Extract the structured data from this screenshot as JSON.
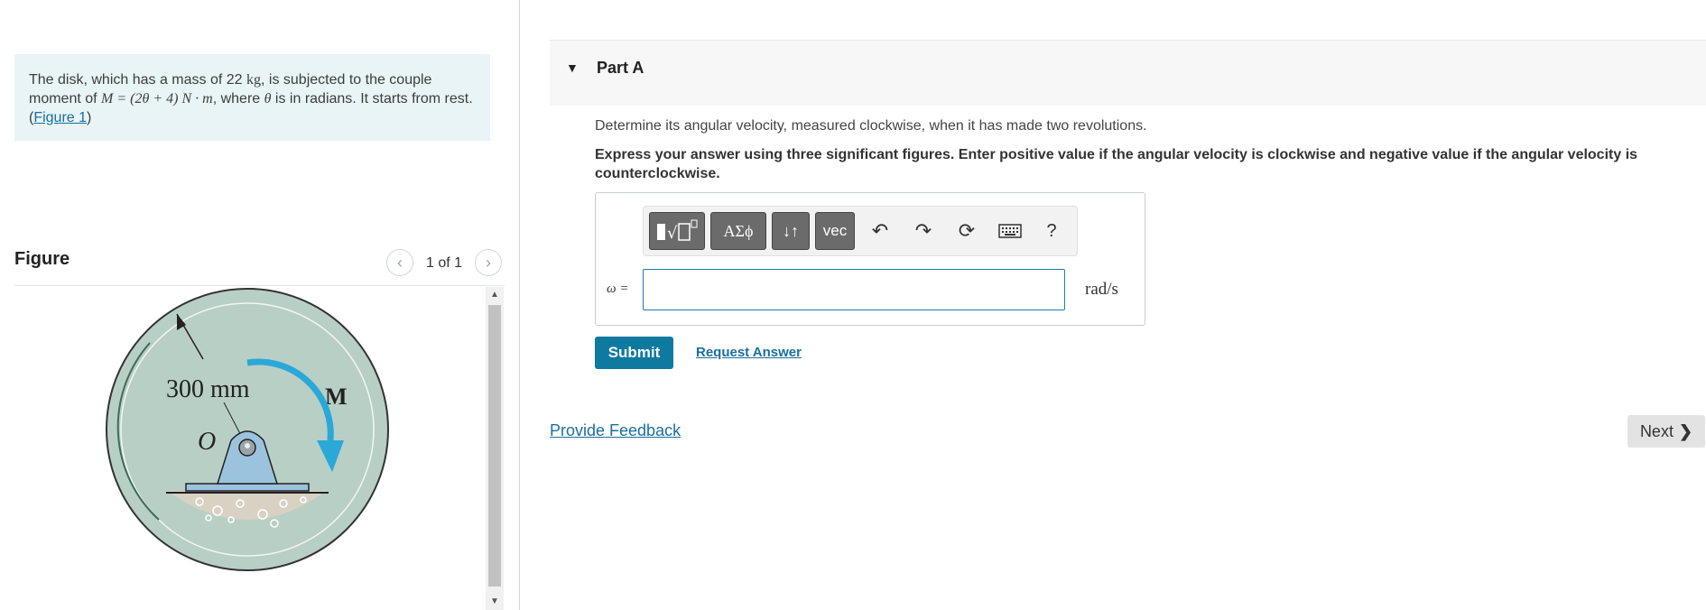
{
  "problem": {
    "text_1": "The disk, which has a mass of 22 ",
    "mass_unit": "kg",
    "text_2": ", is subjected to the couple moment of ",
    "equation": "M = (2θ + 4) N · m",
    "text_3": ", where ",
    "theta": "θ",
    "text_4": " is in radians. It starts from rest. (",
    "figure_link": "Figure 1",
    "text_5": ")"
  },
  "figure": {
    "title": "Figure",
    "prev_icon": "chevron-left-icon",
    "next_icon": "chevron-right-icon",
    "counter": "1 of 1",
    "labels": {
      "radius": "300 mm",
      "moment": "M",
      "origin": "O"
    },
    "colors": {
      "disk": "#b8cfc5",
      "arrow": "#2aa8d8",
      "pin": "#9cc3de",
      "ground": "#d9d2c4"
    }
  },
  "part": {
    "caret_icon": "caret-down-icon",
    "title": "Part A",
    "question": "Determine its angular velocity, measured clockwise, when it has made two revolutions.",
    "instruction": "Express your answer using three significant figures. Enter positive value if the angular velocity is clockwise and negative value if the angular velocity is counterclockwise."
  },
  "toolbar": {
    "templates_icon": "templates-icon",
    "greek_label": "ΑΣϕ",
    "arrows_label": "↓↑",
    "vec_label": "vec",
    "undo_icon": "undo-icon",
    "redo_icon": "redo-icon",
    "reset_icon": "reset-icon",
    "keyboard_icon": "keyboard-icon",
    "help_label": "?"
  },
  "answer": {
    "label": "ω =",
    "value": "",
    "unit": "rad/s"
  },
  "buttons": {
    "submit": "Submit",
    "request_answer": "Request Answer",
    "provide_feedback": "Provide Feedback",
    "next": "Next"
  },
  "colors": {
    "accent": "#0f7a9f",
    "link": "#1a6f9e",
    "problem_bg": "#e8f4f5"
  }
}
